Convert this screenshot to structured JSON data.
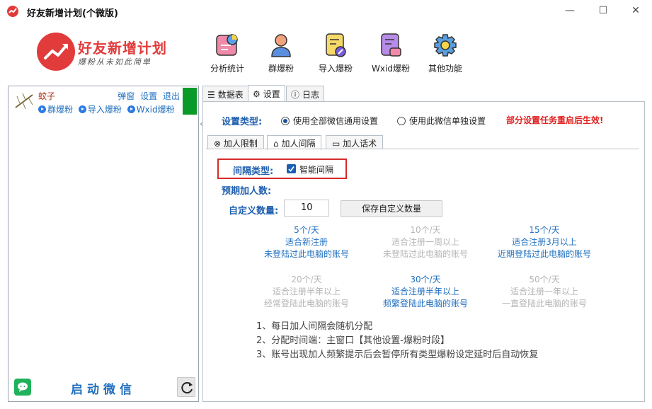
{
  "window": {
    "title": "好友新增计划(个微版)",
    "controls": {
      "minimize": "—",
      "maximize": "☐",
      "close": "✕"
    }
  },
  "logo": {
    "title": "好友新增计划",
    "subtitle": "爆粉从未如此简单"
  },
  "toolbar": [
    {
      "label": "分析统计",
      "icon": "chart-icon"
    },
    {
      "label": "群爆粉",
      "icon": "person-icon"
    },
    {
      "label": "导入爆粉",
      "icon": "import-doc-icon"
    },
    {
      "label": "Wxid爆粉",
      "icon": "wxid-doc-icon"
    },
    {
      "label": "其他功能",
      "icon": "gear-icon"
    }
  ],
  "account": {
    "name": "蚊子",
    "actions": [
      "弹窗",
      "设置",
      "退出"
    ],
    "links": [
      "群爆粉",
      "导入爆粉",
      "Wxid爆粉"
    ],
    "status_color": "#0a9a2a"
  },
  "left_footer": {
    "start_label": "启动微信"
  },
  "tabs": [
    {
      "label": "数据表",
      "icon": "list-icon"
    },
    {
      "label": "设置",
      "icon": "gear-icon"
    },
    {
      "label": "日志",
      "icon": "info-icon"
    }
  ],
  "settings": {
    "type_label": "设置类型:",
    "options": [
      "使用全部微信通用设置",
      "使用此微信单独设置"
    ],
    "selected_option": 0,
    "warning": "部分设置任务重启后生效!",
    "subtabs": [
      {
        "label": "加人限制",
        "icon": "cancel-circle-icon"
      },
      {
        "label": "加人间隔",
        "icon": "tag-icon"
      },
      {
        "label": "加人话术",
        "icon": "chat-icon"
      }
    ],
    "interval_label": "间隔类型:",
    "smart_interval_label": "智能间隔",
    "smart_interval_checked": true,
    "expected_label": "预期加人数:",
    "custom_label": "自定义数量:",
    "custom_value": "10",
    "save_button": "保存自定义数量",
    "rates": [
      {
        "amount": "5个/天",
        "line1": "适合新注册",
        "line2": "未登陆过此电脑的账号",
        "active": true
      },
      {
        "amount": "10个/天",
        "line1": "适合注册一周以上",
        "line2": "未登陆过此电脑的账号",
        "active": false
      },
      {
        "amount": "15个/天",
        "line1": "适合注册3月以上",
        "line2": "近期登陆过此电脑的账号",
        "active": true
      },
      {
        "amount": "20个/天",
        "line1": "适合注册半年以上",
        "line2": "经常登陆此电脑的账号",
        "active": false
      },
      {
        "amount": "30个/天",
        "line1": "适合注册半年以上",
        "line2": "频繁登陆此电脑的账号",
        "active": true
      },
      {
        "amount": "50个/天",
        "line1": "适合注册一年以上",
        "line2": "一直登陆此电脑的账号",
        "active": false
      }
    ],
    "notes": [
      "1、每日加人间隔会随机分配",
      "2、分配时间端：主窗口【其他设置-爆粉时段】",
      "3、账号出现加人频繁提示后会暂停所有类型爆粉设定延时后自动恢复"
    ]
  },
  "colors": {
    "accent": "#1f6fbf",
    "label_blue": "#1f5fae",
    "warning_red": "#e02020",
    "brand_red": "#e23b3b"
  }
}
